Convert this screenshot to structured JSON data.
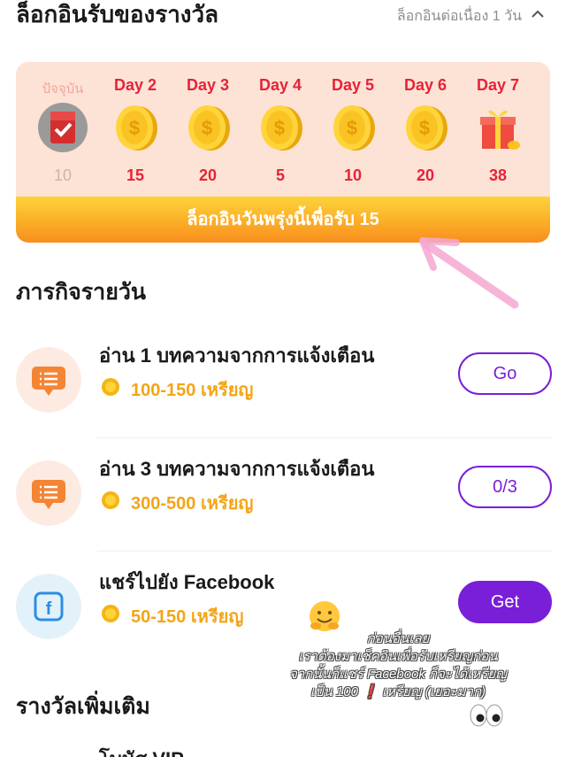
{
  "header": {
    "title": "ล็อกอินรับของรางวัล",
    "streak_text": "ล็อกอินต่อเนื่อง 1 วัน",
    "collapse_icon": "chevron-up-icon"
  },
  "checkin": {
    "days": [
      {
        "label": "ปัจจุบัน",
        "value": "10",
        "icon": "red-envelope-checked-icon",
        "today": true
      },
      {
        "label": "Day 2",
        "value": "15",
        "icon": "gold-coin-icon"
      },
      {
        "label": "Day 3",
        "value": "20",
        "icon": "gold-coin-icon"
      },
      {
        "label": "Day 4",
        "value": "5",
        "icon": "gold-coin-icon"
      },
      {
        "label": "Day 5",
        "value": "10",
        "icon": "gold-coin-icon"
      },
      {
        "label": "Day 6",
        "value": "20",
        "icon": "gold-coin-icon"
      },
      {
        "label": "Day 7",
        "value": "38",
        "icon": "gift-box-icon"
      }
    ],
    "button_label": "ล็อกอินวันพรุ่งนี้เพื่อรับ 15"
  },
  "daily_tasks": {
    "title": "ภารกิจรายวัน",
    "tasks": [
      {
        "name": "อ่าน 1 บทความจากการแจ้งเตือน",
        "reward": "100-150 เหรียญ",
        "button": "Go",
        "icon": "message-icon"
      },
      {
        "name": "อ่าน 3 บทความจากการแจ้งเตือน",
        "reward": "300-500 เหรียญ",
        "button": "0/3",
        "icon": "message-icon"
      },
      {
        "name": "แชร์ไปยัง Facebook",
        "reward": "50-150 เหรียญ",
        "button": "Get",
        "icon": "facebook-icon"
      }
    ]
  },
  "more_rewards": {
    "title": "รางวัลเพิ่มเติม",
    "first_item": "โบนัส VIP"
  },
  "annotation": {
    "lines": [
      "ก่อนอื่นเลย",
      "เราต้องมาเช็คอินเพื่อรับเหรียญก่อน",
      "จากนั้นก็แชร์ Facebook ก็จะได้เหรียญ",
      "เป็น 100 ❗ เหรียญ (เยอะมาก)"
    ]
  },
  "colors": {
    "accent_purple": "#7a1fd8",
    "day_red": "#e5233a",
    "coin_gold": "#f4a516",
    "card_bg": "#fde3d5"
  }
}
